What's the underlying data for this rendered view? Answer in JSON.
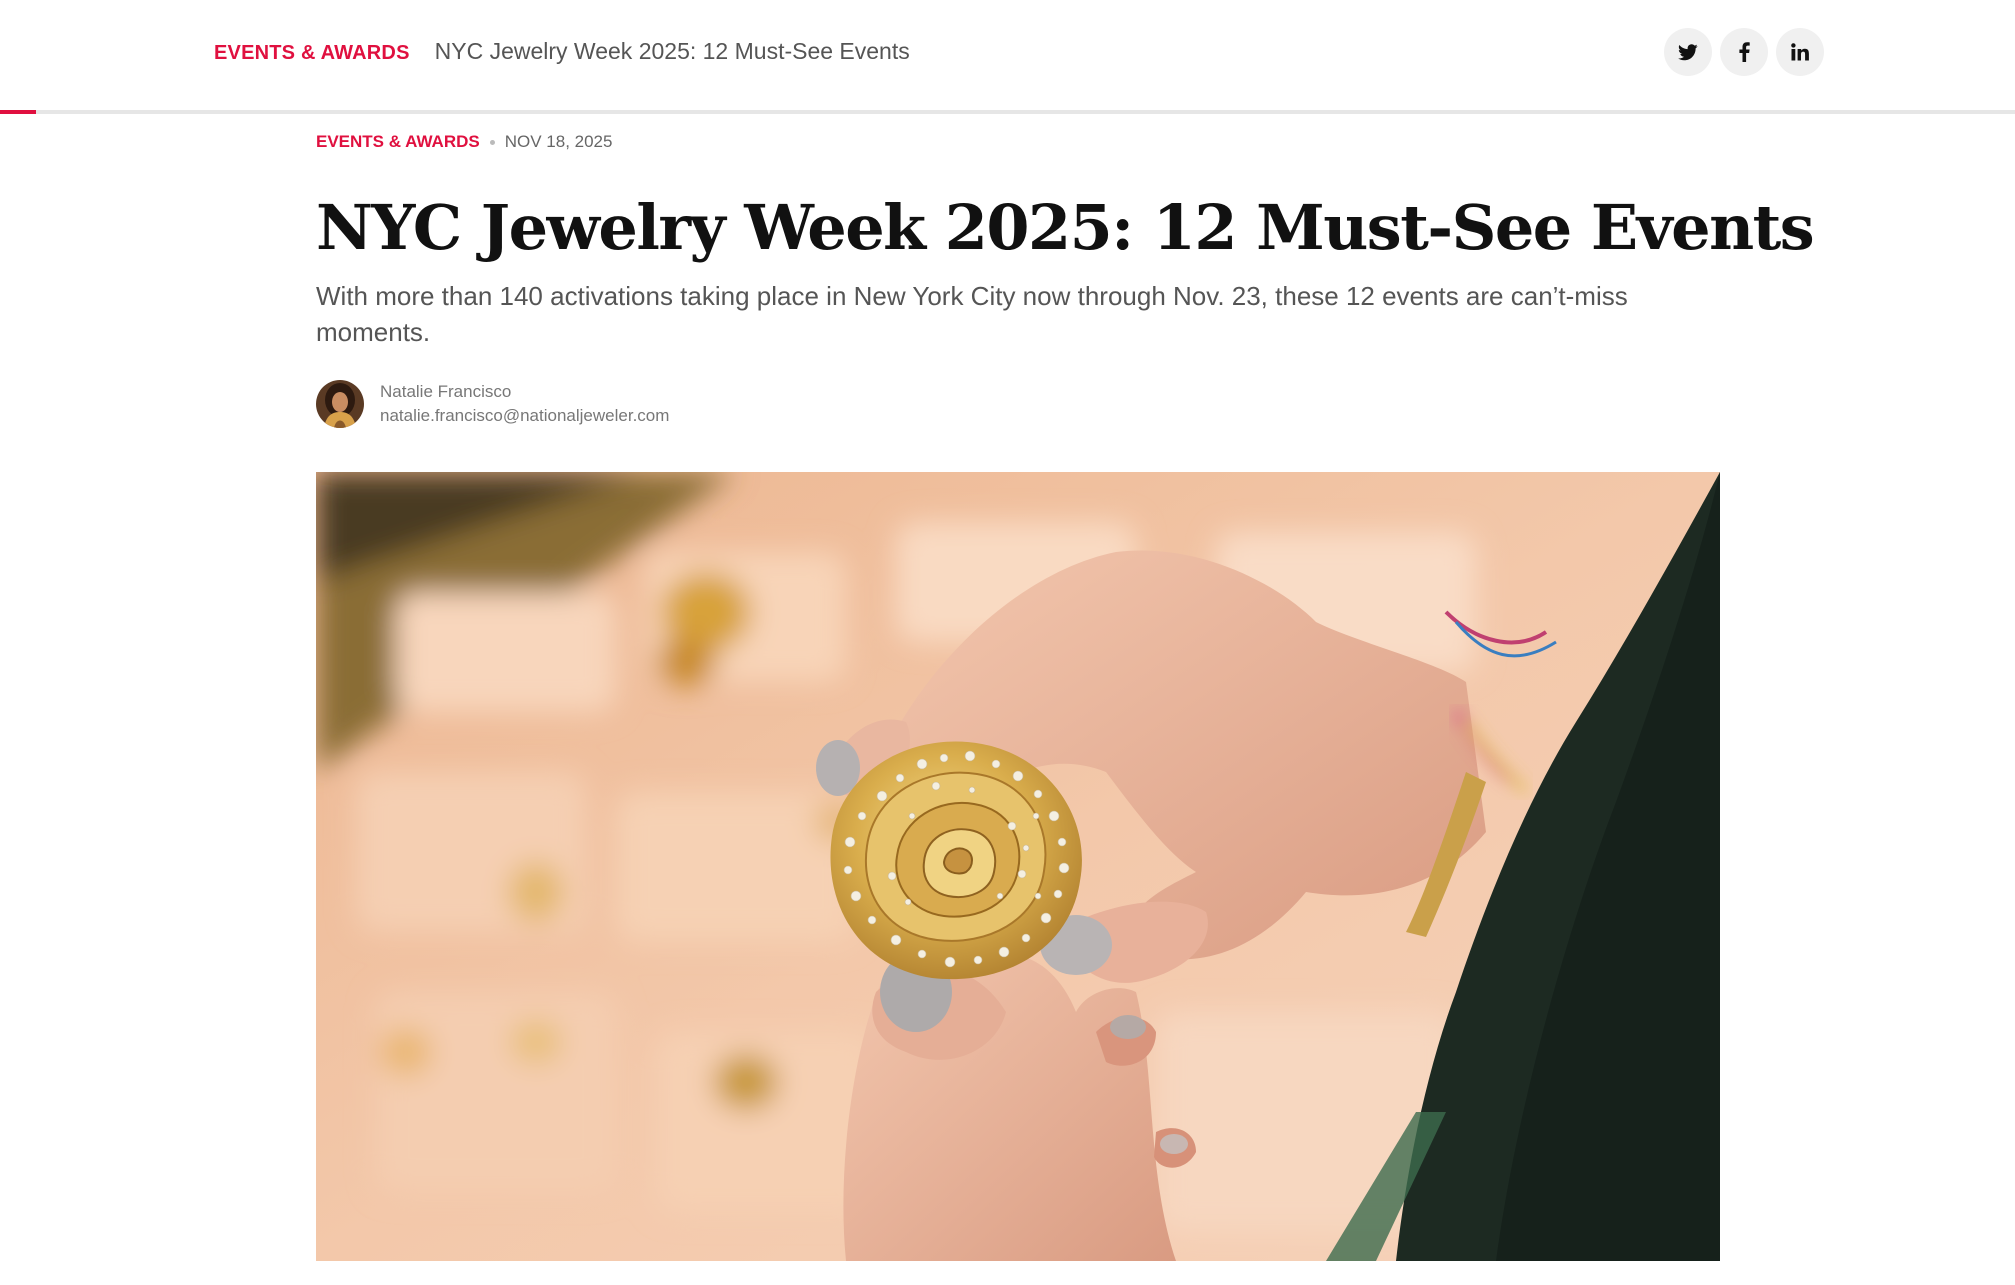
{
  "topbar": {
    "category": "EVENTS & AWARDS",
    "title": "NYC Jewelry Week 2025: 12 Must-See Events",
    "share": [
      {
        "network": "twitter",
        "icon": "twitter-icon"
      },
      {
        "network": "facebook",
        "icon": "facebook-icon"
      },
      {
        "network": "linkedin",
        "icon": "linkedin-icon"
      }
    ],
    "progress_fraction": 0.018
  },
  "article": {
    "category": "EVENTS & AWARDS",
    "date": "NOV 18, 2025",
    "headline": "NYC Jewelry Week 2025: 12 Must-See Events",
    "dek": "With more than 140 activations taking place in New York City now through Nov. 23, these 12 events are can’t-miss moments.",
    "author": {
      "name": "Natalie Francisco",
      "email": "natalie.francisco@nationaljeweler.com"
    }
  },
  "colors": {
    "accent": "#e0103f",
    "text": "#111111",
    "muted": "#555555"
  }
}
